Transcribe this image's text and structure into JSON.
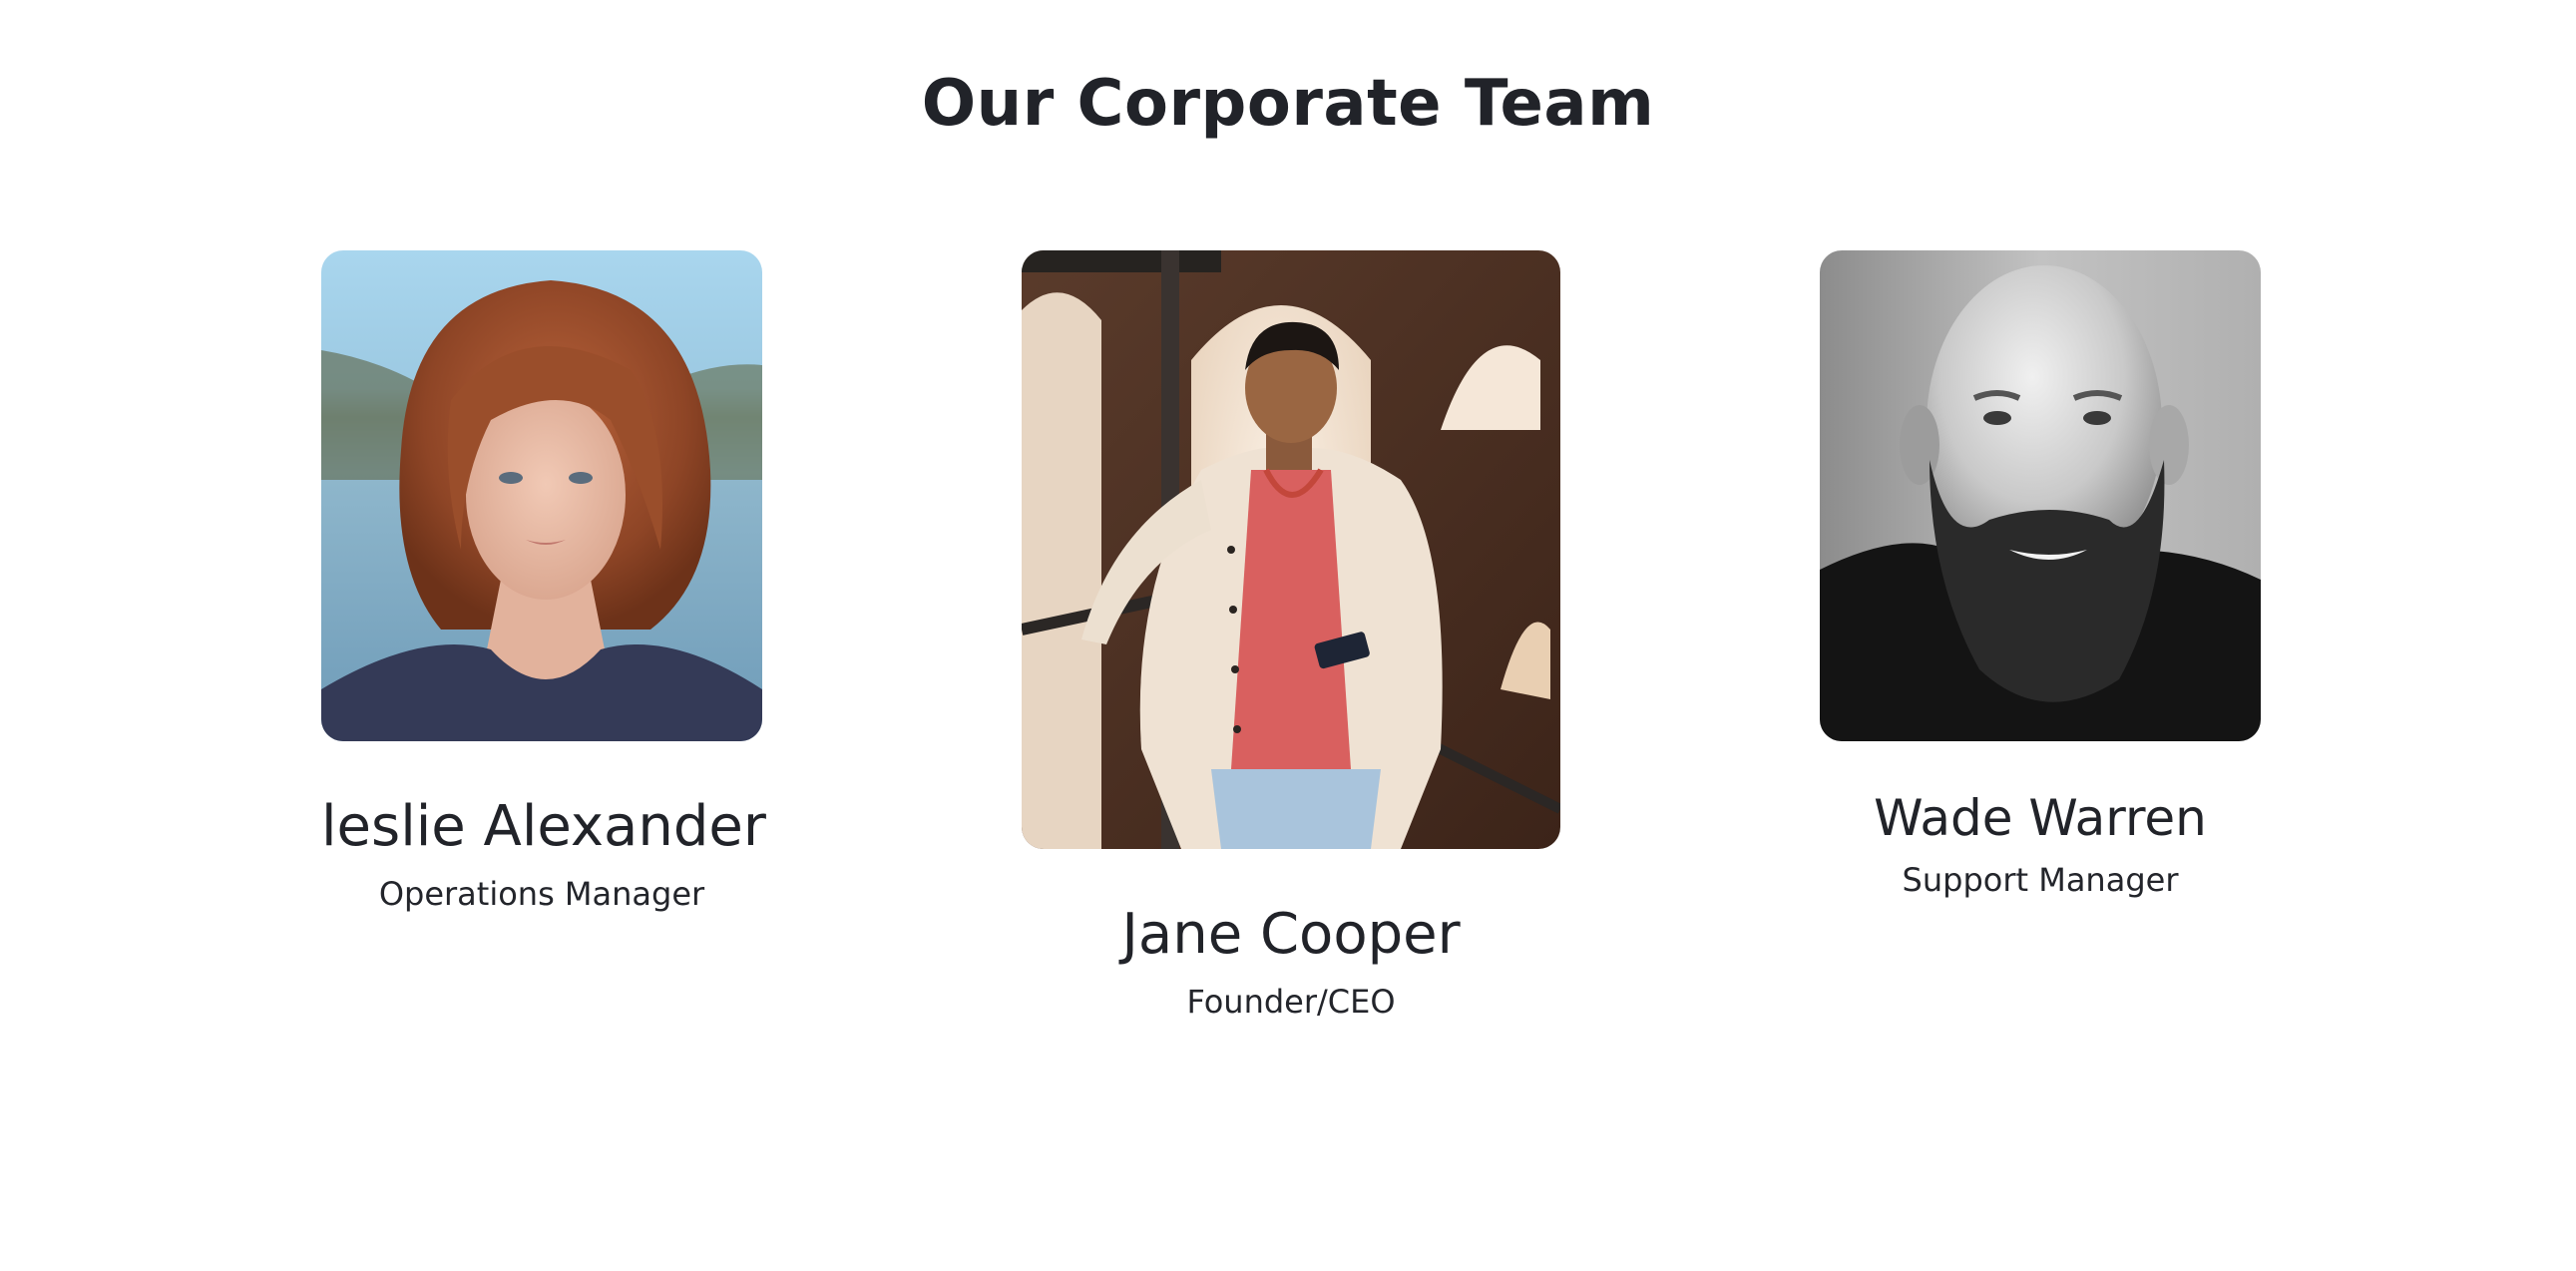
{
  "page": {
    "title": "Our Corporate Team"
  },
  "team": [
    {
      "name": "leslie Alexander",
      "role": "Operations Manager",
      "photo": "portrait-woman-red-hair"
    },
    {
      "name": "Jane Cooper",
      "role": "Founder/CEO",
      "photo": "portrait-man-cream-jacket"
    },
    {
      "name": "Wade Warren",
      "role": "Support Manager",
      "photo": "portrait-bearded-man-bw"
    }
  ],
  "colors": {
    "text": "#212329",
    "background": "#ffffff"
  }
}
